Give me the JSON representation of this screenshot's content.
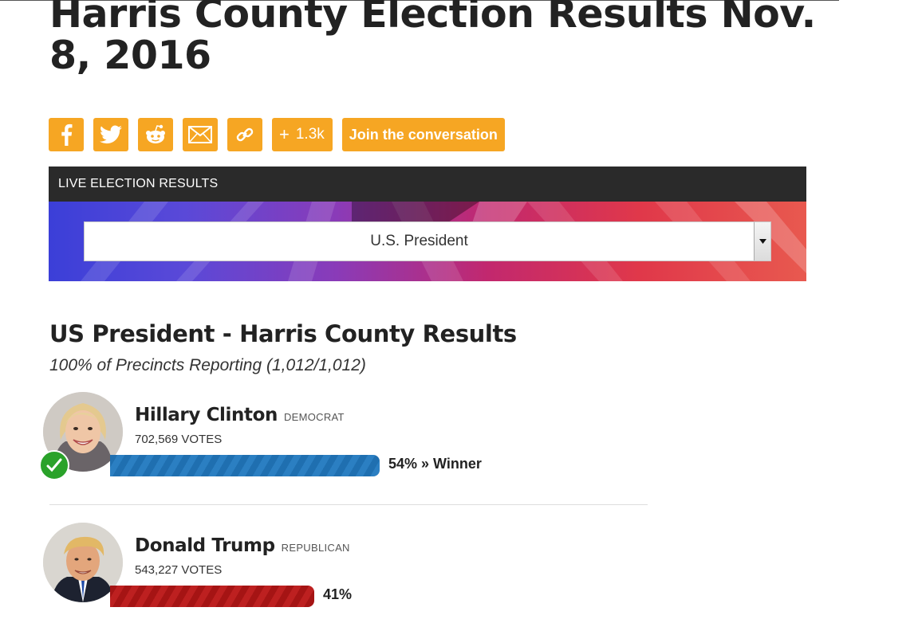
{
  "headline": "Harris County Election Results Nov. 8, 2016",
  "share_bar": {
    "buttons": [
      {
        "icon": "facebook-icon"
      },
      {
        "icon": "twitter-icon"
      },
      {
        "icon": "reddit-icon"
      },
      {
        "icon": "email-icon"
      },
      {
        "icon": "link-icon"
      }
    ],
    "count_plus": "+",
    "count": "1.3k",
    "join_label": "Join the conversation",
    "accent": "#f6a623"
  },
  "widget": {
    "header": "LIVE ELECTION RESULTS",
    "select_value": "U.S. President"
  },
  "results": {
    "title": "US President - Harris County Results",
    "reporting": "100% of Precincts Reporting (1,012/1,012)",
    "candidates": [
      {
        "name": "Hillary Clinton",
        "party": "DEMOCRAT",
        "votes": "702,569 VOTES",
        "percent": 54,
        "result_label": "54% » Winner",
        "winner": true,
        "color": "#2b7fc2"
      },
      {
        "name": "Donald Trump",
        "party": "REPUBLICAN",
        "votes": "543,227 VOTES",
        "percent": 41,
        "result_label": "41%",
        "winner": false,
        "color": "#bd2020"
      }
    ]
  }
}
